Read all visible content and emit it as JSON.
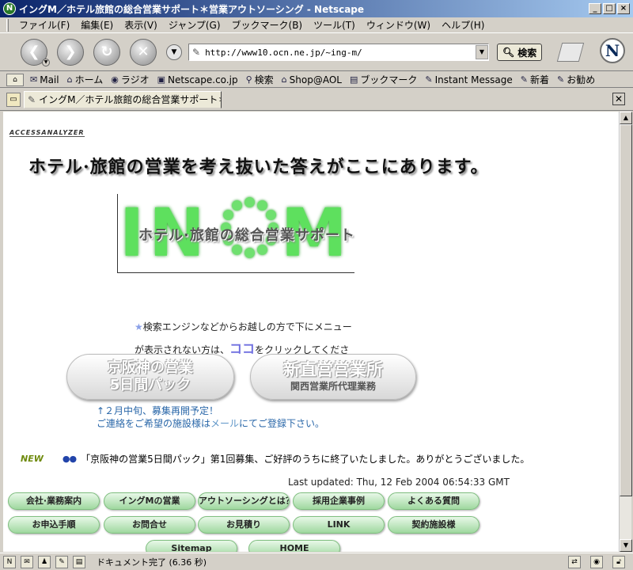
{
  "window": {
    "title": "イングM／ホテル旅館の総合営業サポート＊営業アウトソーシング - Netscape",
    "app_icon": "N",
    "controls": [
      "_",
      "□",
      "×"
    ]
  },
  "menubar": [
    "ファイル(F)",
    "編集(E)",
    "表示(V)",
    "ジャンプ(G)",
    "ブックマーク(B)",
    "ツール(T)",
    "ウィンドウ(W)",
    "ヘルプ(H)"
  ],
  "navbar": {
    "url": "http://www10.ocn.ne.jp/~ing-m/",
    "search_label": "検索",
    "logo": "N"
  },
  "personal_toolbar": [
    "Mail",
    "ホーム",
    "ラジオ",
    "Netscape.co.jp",
    "検索",
    "Shop@AOL",
    "ブックマーク",
    "Instant Message",
    "新着",
    "お勧め"
  ],
  "tab": {
    "label": "イングM／ホテル旅館の総合営業サポート＊..."
  },
  "page": {
    "counter_logo": "ACCESSANALYZER",
    "headline": "ホテル·旅館の営業を考え抜いた答えがここにあります。",
    "banner": {
      "left_text": "IN",
      "right_text": "M",
      "subtitle": "ホテル·旅館の総合営業サポート"
    },
    "notice_line1": "検索エンジンなどからお越しの方で下にメニュー",
    "notice_line2_pre": "が表示されない方は、",
    "notice_link": "ココ",
    "notice_line2_post": "をクリックしてくださ",
    "pill_left": {
      "line1": "京阪神の営業",
      "line2": "5日間パック"
    },
    "pill_right": {
      "line1": "新直営営業所",
      "line2": "関西営業所代理業務"
    },
    "update_line1": "↑２月中旬、募集再開予定！",
    "update_line2_pre": "ご連絡をご希望の施設様は",
    "update_line2_link": "メール",
    "update_line2_post": "にてご登録下さい。",
    "new_badge": "NEW",
    "new_text": "「京阪神の営業5日間パック」第1回募集、ご好評のうちに終了いたしました。ありがとうございました。",
    "last_updated": "Last updated: Thu, 12 Feb 2004 06:54:33 GMT",
    "nav_buttons_row1": [
      "会社·業務案内",
      "イングMの営業",
      "アウトソーシングとは？",
      "採用企業事例",
      "よくある質問"
    ],
    "nav_buttons_row2": [
      "お申込手順",
      "お問合せ",
      "お見積り",
      "LINK",
      "契約施設様"
    ],
    "nav_buttons_row3": [
      "Sitemap",
      "HOME"
    ]
  },
  "status": {
    "text": "ドキュメント完了 (6.36 秒)"
  }
}
